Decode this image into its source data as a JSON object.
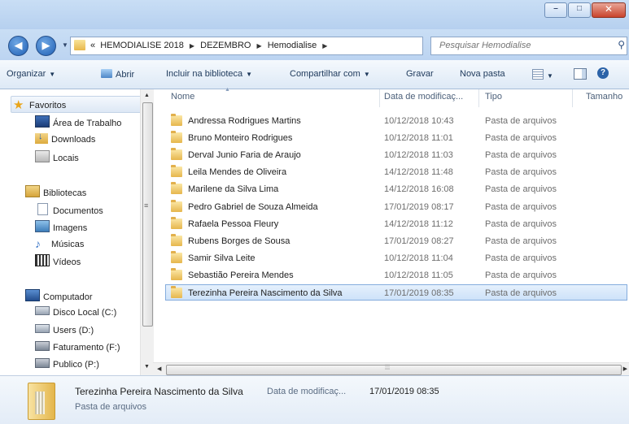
{
  "window": {
    "controls": {
      "minimize": "–",
      "maximize": "□",
      "close": "✕"
    }
  },
  "address": {
    "prefix": "«",
    "crumbs": [
      "HEMODIALISE 2018",
      "DEZEMBRO",
      "Hemodialise"
    ],
    "search_placeholder": "Pesquisar Hemodialise"
  },
  "toolbar": {
    "organize": "Organizar",
    "open": "Abrir",
    "include_library": "Incluir na biblioteca",
    "share_with": "Compartilhar com",
    "burn": "Gravar",
    "new_folder": "Nova pasta"
  },
  "nav": {
    "favorites": "Favoritos",
    "fav_items": [
      "Área de Trabalho",
      "Downloads",
      "Locais"
    ],
    "libraries": "Bibliotecas",
    "lib_items": [
      "Documentos",
      "Imagens",
      "Músicas",
      "Vídeos"
    ],
    "computer": "Computador",
    "drives": [
      "Disco Local (C:)",
      "Users (D:)",
      "Faturamento (F:)",
      "Publico (P:)"
    ]
  },
  "columns": {
    "name": "Nome",
    "date": "Data de modificaç...",
    "type": "Tipo",
    "size": "Tamanho"
  },
  "files": [
    {
      "name": "Andressa Rodrigues Martins",
      "date": "10/12/2018 10:43",
      "type": "Pasta de arquivos"
    },
    {
      "name": "Bruno Monteiro Rodrigues",
      "date": "10/12/2018 11:01",
      "type": "Pasta de arquivos"
    },
    {
      "name": "Derval Junio Faria de Araujo",
      "date": "10/12/2018 11:03",
      "type": "Pasta de arquivos"
    },
    {
      "name": "Leila Mendes de Oliveira",
      "date": "14/12/2018 11:48",
      "type": "Pasta de arquivos"
    },
    {
      "name": "Marilene da Silva Lima",
      "date": "14/12/2018 16:08",
      "type": "Pasta de arquivos"
    },
    {
      "name": "Pedro Gabriel de Souza Almeida",
      "date": "17/01/2019 08:17",
      "type": "Pasta de arquivos"
    },
    {
      "name": "Rafaela Pessoa Fleury",
      "date": "14/12/2018 11:12",
      "type": "Pasta de arquivos"
    },
    {
      "name": "Rubens Borges de Sousa",
      "date": "17/01/2019 08:27",
      "type": "Pasta de arquivos"
    },
    {
      "name": "Samir Silva Leite",
      "date": "10/12/2018 11:04",
      "type": "Pasta de arquivos"
    },
    {
      "name": "Sebastião Pereira Mendes",
      "date": "10/12/2018 11:05",
      "type": "Pasta de arquivos"
    },
    {
      "name": "Terezinha Pereira Nascimento da Silva",
      "date": "17/01/2019 08:35",
      "type": "Pasta de arquivos",
      "selected": true
    }
  ],
  "details": {
    "name": "Terezinha Pereira Nascimento da Silva",
    "modified_label": "Data de modificaç...",
    "modified_value": "17/01/2019 08:35",
    "type": "Pasta de arquivos"
  }
}
